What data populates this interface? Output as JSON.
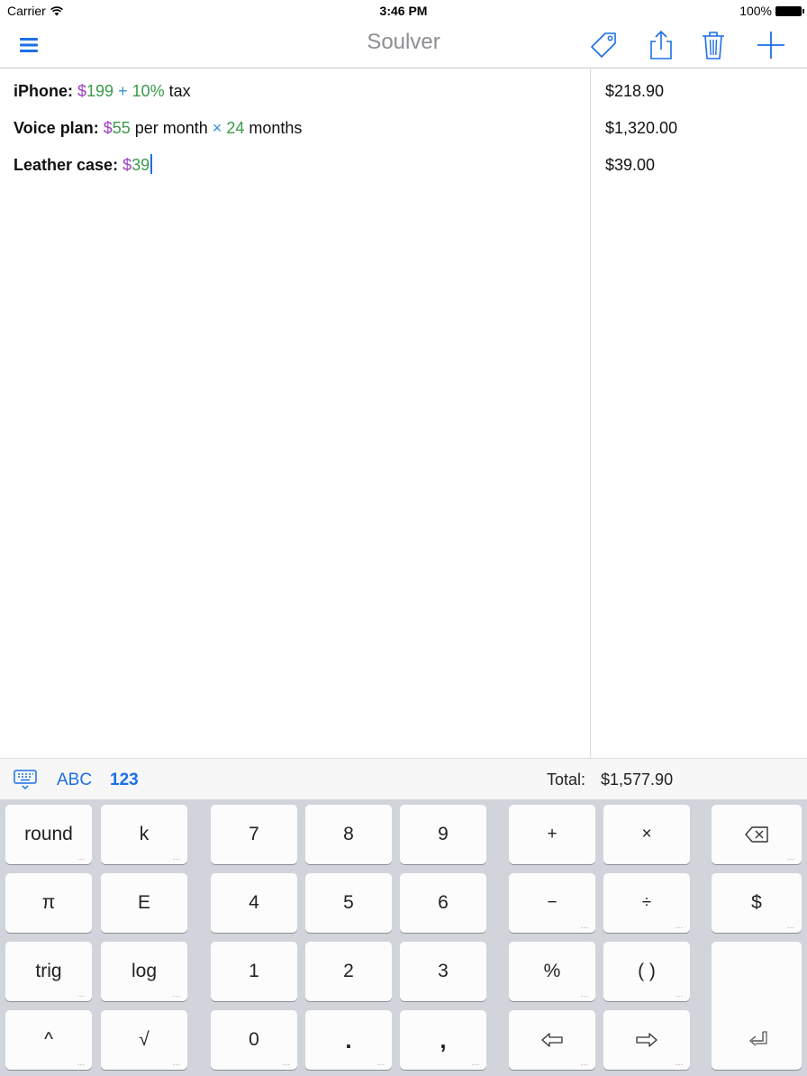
{
  "status_bar": {
    "carrier": "Carrier",
    "time": "3:46 PM",
    "battery": "100%"
  },
  "nav": {
    "title": "Soulver",
    "menu_icon": "hamburger-menu-icon",
    "actions": [
      "tag-icon",
      "share-icon",
      "trash-icon",
      "plus-icon"
    ]
  },
  "lines": [
    {
      "label": "iPhone:",
      "tokens": [
        {
          "text": "$",
          "kind": "currency"
        },
        {
          "text": "199",
          "kind": "number"
        },
        {
          "text": " + ",
          "kind": "op"
        },
        {
          "text": "10%",
          "kind": "number"
        },
        {
          "text": " tax",
          "kind": "text"
        }
      ],
      "result": "$218.90"
    },
    {
      "label": "Voice plan:",
      "tokens": [
        {
          "text": "$",
          "kind": "currency"
        },
        {
          "text": "55",
          "kind": "number"
        },
        {
          "text": " per month ",
          "kind": "text"
        },
        {
          "text": "×",
          "kind": "op"
        },
        {
          "text": " 24",
          "kind": "number"
        },
        {
          "text": " months",
          "kind": "text"
        }
      ],
      "result": "$1,320.00"
    },
    {
      "label": "Leather case:",
      "tokens": [
        {
          "text": "$",
          "kind": "currency"
        },
        {
          "text": "39",
          "kind": "number"
        }
      ],
      "result": "$39.00",
      "cursor": true
    }
  ],
  "toolbar": {
    "keyboard_icon": "keyboard-icon",
    "mode_abc": "ABC",
    "mode_123": "123",
    "total_label": "Total:",
    "total_value": "$1,577.90"
  },
  "keyboard": {
    "rows": [
      [
        "round",
        "k",
        "7",
        "8",
        "9",
        "+",
        "×",
        "⌫"
      ],
      [
        "π",
        "E",
        "4",
        "5",
        "6",
        "−",
        "÷",
        "$"
      ],
      [
        "trig",
        "log",
        "1",
        "2",
        "3",
        "%",
        "( )",
        "⏎"
      ],
      [
        "^",
        "√",
        "0",
        ".",
        ",",
        "⇦",
        "⇨",
        ""
      ]
    ],
    "has_more": [
      [
        true,
        true,
        false,
        false,
        false,
        false,
        false,
        true
      ],
      [
        false,
        false,
        false,
        false,
        false,
        true,
        true,
        true
      ],
      [
        true,
        true,
        false,
        false,
        false,
        true,
        true,
        false
      ],
      [
        true,
        true,
        true,
        true,
        true,
        true,
        true,
        false
      ]
    ]
  },
  "colors": {
    "accent": "#1d6fe6",
    "currency": "#9b3fc0",
    "number": "#3a9a4a",
    "operator": "#3a8fcf"
  }
}
